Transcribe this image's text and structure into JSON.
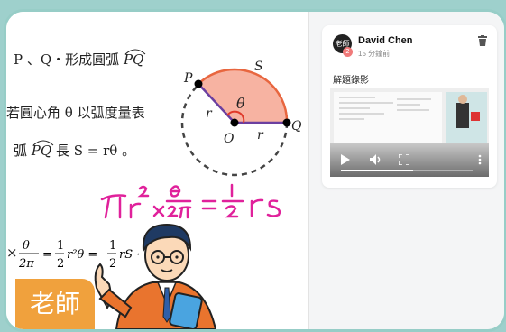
{
  "board": {
    "line1_pre": "P 、Q・形成圓弧",
    "line1_arc": "PQ",
    "line2": "若圓心角 θ 以弧度量表",
    "line3_pre": "弧",
    "line3_arc": "PQ",
    "line3_post": "長 S = rθ 。",
    "formula_handwritten": "πr² × θ/2π = ½ rS",
    "formula_typed_lhs": "×",
    "formula_typed": "θ/2π = ½r²θ = ½rS 。",
    "diagram": {
      "label_p": "P",
      "label_q": "Q",
      "label_o": "O",
      "label_s": "S",
      "label_r_left": "r",
      "label_r_bottom": "r",
      "label_theta": "θ"
    },
    "teacher_label": "老師",
    "handwriting_color": "#e0219b",
    "sector_color": "#f7b3a2",
    "label_color": "#f0a13d"
  },
  "post": {
    "avatar_text": "老師",
    "badge_text": "2",
    "author": "David Chen",
    "time": "15 分鐘前",
    "caption": "解題錄影",
    "delete_icon": "trash-icon",
    "video": {
      "play_icon": "play-icon",
      "volume_icon": "volume-icon",
      "fullscreen_icon": "fullscreen-icon",
      "more_icon": "more-vertical-icon",
      "progress": 0.55
    }
  }
}
